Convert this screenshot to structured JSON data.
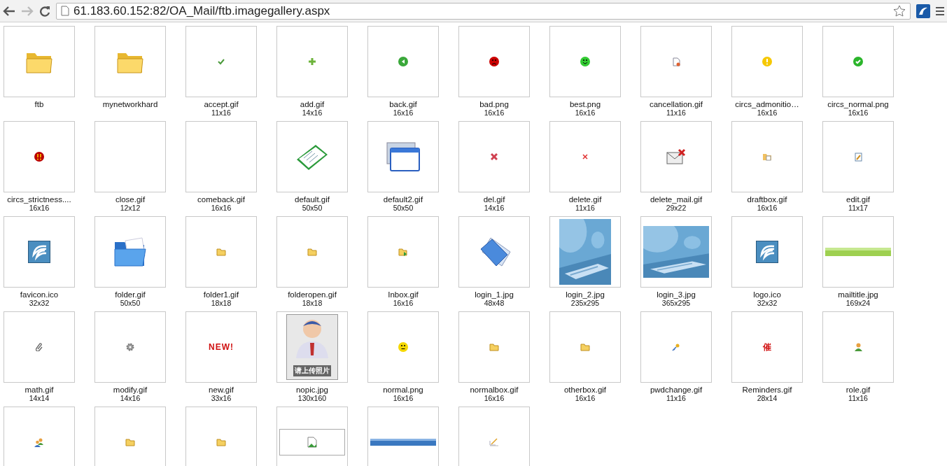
{
  "browser": {
    "url": "61.183.60.152:82/OA_Mail/ftb.imagegallery.aspx"
  },
  "gallery": [
    {
      "name": "ftb",
      "kind": "folder"
    },
    {
      "name": "mynetworkhard",
      "kind": "folder"
    },
    {
      "name": "accept.gif",
      "size": "11x16",
      "kind": "tick"
    },
    {
      "name": "add.gif",
      "size": "14x16",
      "kind": "plus"
    },
    {
      "name": "back.gif",
      "size": "16x16",
      "kind": "back"
    },
    {
      "name": "bad.png",
      "size": "16x16",
      "kind": "sad"
    },
    {
      "name": "best.png",
      "size": "16x16",
      "kind": "smile"
    },
    {
      "name": "cancellation.gif",
      "size": "11x16",
      "kind": "doc"
    },
    {
      "name": "circs_admonitio…",
      "size": "16x16",
      "kind": "warn"
    },
    {
      "name": "circs_normal.png",
      "size": "16x16",
      "kind": "ok"
    },
    {
      "name": "circs_strictness....",
      "size": "16x16",
      "kind": "alert"
    },
    {
      "name": "close.gif",
      "size": "12x12",
      "kind": "blank"
    },
    {
      "name": "comeback.gif",
      "size": "16x16",
      "kind": "blank"
    },
    {
      "name": "default.gif",
      "size": "50x50",
      "kind": "book"
    },
    {
      "name": "default2.gif",
      "size": "50x50",
      "kind": "window"
    },
    {
      "name": "del.gif",
      "size": "14x16",
      "kind": "cross"
    },
    {
      "name": "delete.gif",
      "size": "11x16",
      "kind": "cross-small"
    },
    {
      "name": "delete_mail.gif",
      "size": "29x22",
      "kind": "mail"
    },
    {
      "name": "draftbox.gif",
      "size": "16x16",
      "kind": "drafts"
    },
    {
      "name": "edit.gif",
      "size": "11x17",
      "kind": "edit"
    },
    {
      "name": "favicon.ico",
      "size": "32x32",
      "kind": "logo"
    },
    {
      "name": "folder.gif",
      "size": "50x50",
      "kind": "blue-folder"
    },
    {
      "name": "folder1.gif",
      "size": "18x18",
      "kind": "small-folder"
    },
    {
      "name": "folderopen.gif",
      "size": "18x18",
      "kind": "small-folder"
    },
    {
      "name": "Inbox.gif",
      "size": "16x16",
      "kind": "inbox"
    },
    {
      "name": "login_1.jpg",
      "size": "48x48",
      "kind": "blue-folders"
    },
    {
      "name": "login_2.jpg",
      "size": "235x295",
      "kind": "picture-tall"
    },
    {
      "name": "login_3.jpg",
      "size": "365x295",
      "kind": "picture-wide"
    },
    {
      "name": "logo.ico",
      "size": "32x32",
      "kind": "logo"
    },
    {
      "name": "mailtitle.jpg",
      "size": "169x24",
      "kind": "green-bar"
    },
    {
      "name": "math.gif",
      "size": "14x14",
      "kind": "clip"
    },
    {
      "name": "modify.gif",
      "size": "14x16",
      "kind": "gear"
    },
    {
      "name": "new.gif",
      "size": "33x16",
      "kind": "glyph",
      "glyph": "NEW!"
    },
    {
      "name": "nopic.jpg",
      "size": "130x160",
      "kind": "avatar",
      "caption": "请上传照片"
    },
    {
      "name": "normal.png",
      "size": "16x16",
      "kind": "neutral"
    },
    {
      "name": "normalbox.gif",
      "size": "16x16",
      "kind": "small-folder"
    },
    {
      "name": "otherbox.gif",
      "size": "16x16",
      "kind": "small-folder"
    },
    {
      "name": "pwdchange.gif",
      "size": "11x16",
      "kind": "key"
    },
    {
      "name": "Reminders.gif",
      "size": "28x14",
      "kind": "glyph",
      "glyph": "催"
    },
    {
      "name": "role.gif",
      "size": "11x16",
      "kind": "person"
    },
    {
      "kind": "people"
    },
    {
      "kind": "small-folder"
    },
    {
      "kind": "small-folder"
    },
    {
      "kind": "broken"
    },
    {
      "kind": "blue-bar"
    },
    {
      "kind": "pen"
    }
  ]
}
